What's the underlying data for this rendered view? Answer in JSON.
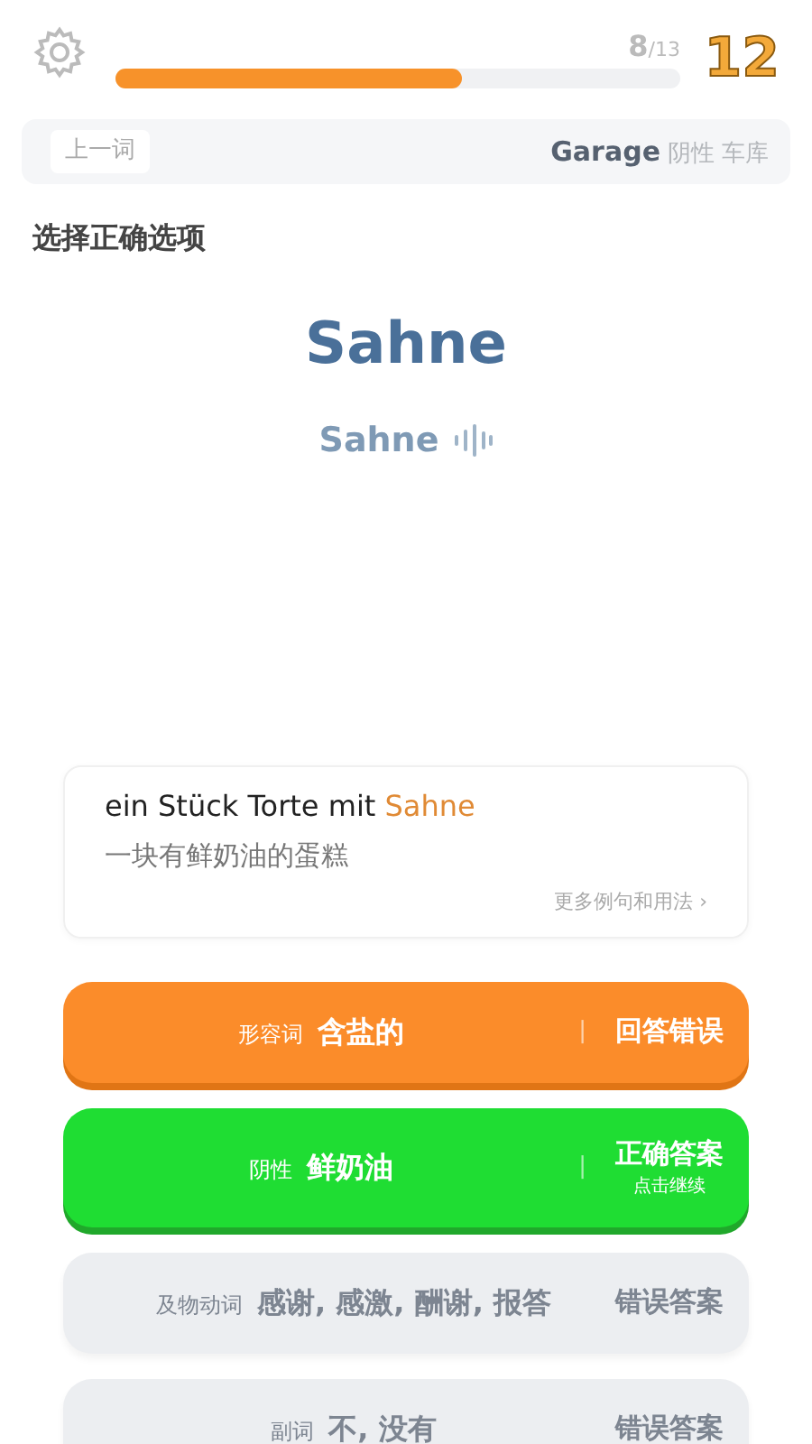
{
  "header": {
    "progress": {
      "level": 0.615,
      "current": "8",
      "total": "/13"
    },
    "score": "12"
  },
  "previous_word": {
    "button": "上一词",
    "word": "Garage",
    "gender": "阴性",
    "meaning": "车库"
  },
  "instruction": "选择正确选项",
  "word": "Sahne",
  "pronunciation": "Sahne",
  "example": {
    "sentence_start": "ein Stück Torte mit ",
    "keyword": "Sahne",
    "translation": "一块有鲜奶油的蛋糕",
    "more_link": "更多例句和用法",
    "more_arrow": "›"
  },
  "options": [
    {
      "kind": "wrong",
      "part_of_speech": "形容词",
      "meaning": "含盐的",
      "separator": "|",
      "result": "回答错误"
    },
    {
      "kind": "correct",
      "part_of_speech": "阴性",
      "meaning": "鲜奶油",
      "separator": "|",
      "result": "正确答案",
      "hint": "点击继续"
    },
    {
      "kind": "faded",
      "part_of_speech": "及物动词",
      "meaning": "感谢, 感激, 酬谢, 报答",
      "result": "错误答案"
    },
    {
      "kind": "faded",
      "part_of_speech": "副词",
      "meaning": "不, 没有",
      "result": "错误答案"
    }
  ]
}
